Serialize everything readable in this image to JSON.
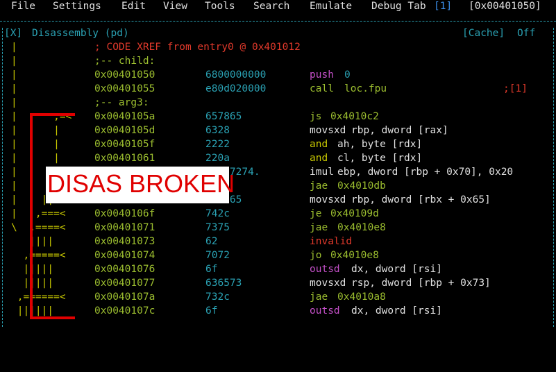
{
  "menubar": {
    "items": [
      "File",
      "Settings",
      "Edit",
      "View",
      "Tools",
      "Search",
      "Emulate",
      "Debug Tab"
    ],
    "seek_index": "[1]",
    "address": "[0x00401050]"
  },
  "panel": {
    "close": "[X]",
    "title": "Disassembly (pd)",
    "cache": "[Cache]",
    "cache_state": "Off"
  },
  "rows": [
    {
      "arrow": "|",
      "text": "; CODE XREF from entry0 @ 0x401012",
      "addr": "",
      "bytes": "",
      "mnem": "",
      "ops": ""
    },
    {
      "arrow": "|",
      "text": ";-- child:",
      "addr": "",
      "bytes": "",
      "mnem": "",
      "ops": ""
    },
    {
      "arrow": "|",
      "text": "",
      "addr": "0x00401050",
      "bytes": "6800000000",
      "mnem": "push",
      "ops": "0"
    },
    {
      "arrow": "|",
      "text": "",
      "addr": "0x00401055",
      "bytes": "e80d020000",
      "mnem": "call",
      "ops": "loc.fpu"
    },
    {
      "arrow": "|",
      "text": ";-- arg3:",
      "addr": "",
      "bytes": "",
      "mnem": "",
      "ops": ""
    },
    {
      "arrow": "|      ,=<",
      "text": "",
      "addr": "0x0040105a",
      "bytes": "657865",
      "mnem": "js",
      "ops": "0x4010c2"
    },
    {
      "arrow": "|      |",
      "text": "",
      "addr": "0x0040105d",
      "bytes": "6328",
      "mnem": "movsxd",
      "ops": "rbp, dword [rax]"
    },
    {
      "arrow": "|      |",
      "text": "",
      "addr": "0x0040105f",
      "bytes": "2222",
      "mnem": "and",
      "ops": "ah, byte [rdx]"
    },
    {
      "arrow": "|      |",
      "text": "",
      "addr": "0x00401061",
      "bytes": "220a",
      "mnem": "and",
      "ops": "cl, byte [rdx]"
    },
    {
      "arrow": "|",
      "text": "",
      "addr": "",
      "bytes": "706f7274.",
      "mnem": "imul",
      "ops": "ebp, dword [rbp + 0x70], 0x20"
    },
    {
      "arrow": "|",
      "text": "",
      "addr": "",
      "bytes": "",
      "mnem": "jae",
      "ops": "0x4010db"
    },
    {
      "arrow": "|    ||",
      "text": "",
      "addr": "",
      "bytes": "6d6365",
      "mnem": "movsxd",
      "ops": "rbp, dword [rbx + 0x65]"
    },
    {
      "arrow": "|   ,===<",
      "text": "",
      "addr": "0x0040106f",
      "bytes": "742c",
      "mnem": "je",
      "ops": "0x40109d"
    },
    {
      "arrow": "\\  ,====<",
      "text": "",
      "addr": "0x00401071",
      "bytes": "7375",
      "mnem": "jae",
      "ops": "0x4010e8"
    },
    {
      "arrow": "   ||||",
      "text": "",
      "addr": "0x00401073",
      "bytes": "62",
      "mnem": "invalid",
      "ops": ""
    },
    {
      "arrow": "  ,=====<",
      "text": "",
      "addr": "0x00401074",
      "bytes": "7072",
      "mnem": "jo",
      "ops": "0x4010e8"
    },
    {
      "arrow": "  |||||",
      "text": "",
      "addr": "0x00401076",
      "bytes": "6f",
      "mnem": "outsd",
      "ops": "dx, dword [rsi]"
    },
    {
      "arrow": "  |||||",
      "text": "",
      "addr": "0x00401077",
      "bytes": "636573",
      "mnem": "movsxd",
      "ops": "rsp, dword [rbp + 0x73]"
    },
    {
      "arrow": " ,======<",
      "text": "",
      "addr": "0x0040107a",
      "bytes": "732c",
      "mnem": "jae",
      "ops": "0x4010a8"
    },
    {
      "arrow": " ||||||",
      "text": "",
      "addr": "0x0040107c",
      "bytes": "6f",
      "mnem": "outsd",
      "ops": "dx, dword [rsi]"
    }
  ],
  "call_comment": ";[1]",
  "overlay": {
    "label": "DISAS BROKEN"
  },
  "colors": {
    "accent": "#2aa1b3",
    "comment": "#e0392b",
    "address": "#9bbd2f",
    "overlay": "#e00000"
  }
}
